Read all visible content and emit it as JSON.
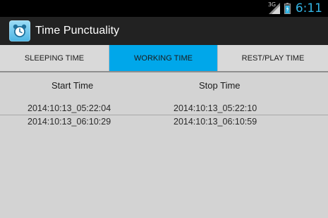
{
  "status_bar": {
    "network_type": "3G",
    "time": "6:11",
    "icons": [
      "signal-icon",
      "battery-icon"
    ]
  },
  "action_bar": {
    "icon": "alarm-clock-icon",
    "title": "Time Punctuality"
  },
  "tabs": [
    {
      "label": "SLEEPING TIME",
      "selected": false
    },
    {
      "label": "WORKING TIME",
      "selected": true
    },
    {
      "label": "REST/PLAY TIME",
      "selected": false
    }
  ],
  "table": {
    "headers": [
      "Start Time",
      "Stop Time"
    ],
    "rows": [
      [
        "2014:10:13_05:22:04",
        "2014:10:13_05:22:10"
      ],
      [
        "2014:10:13_06:10:29",
        "2014:10:13_06:10:59"
      ]
    ]
  },
  "colors": {
    "accent": "#00a7ea",
    "clock": "#33b5e5",
    "action_bar": "#222222",
    "background": "#d3d3d3"
  }
}
